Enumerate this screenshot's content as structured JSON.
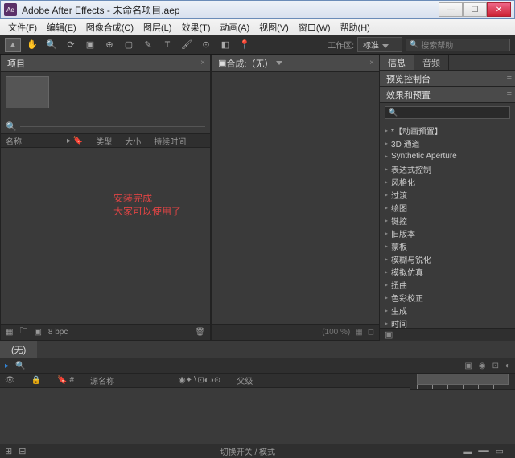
{
  "titlebar": {
    "app": "Adobe After Effects",
    "doc": "未命名项目.aep",
    "icon_label": "Ae"
  },
  "menubar": [
    "文件(F)",
    "编辑(E)",
    "图像合成(C)",
    "图层(L)",
    "效果(T)",
    "动画(A)",
    "视图(V)",
    "窗口(W)",
    "帮助(H)"
  ],
  "toolbar": {
    "workspace_label": "工作区:",
    "workspace_value": "标准",
    "search_placeholder": "搜索帮助"
  },
  "panels": {
    "project": {
      "tab": "项目",
      "columns": [
        "名称",
        "类型",
        "大小",
        "持续时间"
      ],
      "overlay_line1": "安装完成",
      "overlay_line2": "大家可以使用了",
      "footer_bpc": "8 bpc"
    },
    "composition": {
      "tab": "合成:（无）",
      "zoom": "(100 %)"
    },
    "info_tab": "信息",
    "audio_tab": "音频",
    "preview_tab": "预览控制台",
    "effects": {
      "tab": "效果和预置",
      "items": [
        "*【动画预置】",
        "3D 通道",
        "Synthetic Aperture",
        "表达式控制",
        "风格化",
        "过渡",
        "绘图",
        "键控",
        "旧版本",
        "蒙板",
        "模糊与锐化",
        "模拟仿真",
        "扭曲",
        "色彩校正",
        "生成",
        "时间"
      ]
    }
  },
  "timeline": {
    "tab": "(无)",
    "cols": [
      "源名称",
      "父级"
    ],
    "footer_center": "切换开关 / 模式"
  }
}
